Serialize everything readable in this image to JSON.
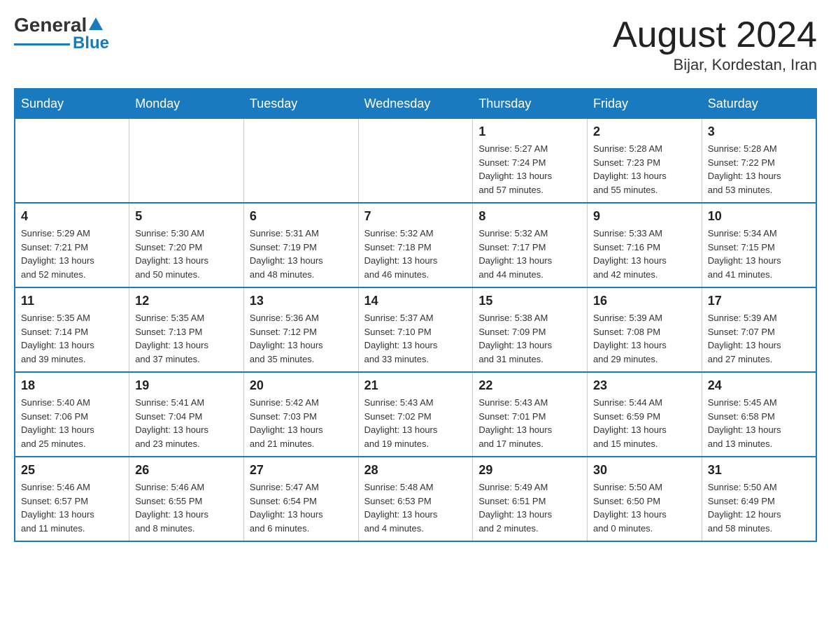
{
  "header": {
    "logo_general": "General",
    "logo_blue": "Blue",
    "month_title": "August 2024",
    "location": "Bijar, Kordestan, Iran"
  },
  "days_of_week": [
    "Sunday",
    "Monday",
    "Tuesday",
    "Wednesday",
    "Thursday",
    "Friday",
    "Saturday"
  ],
  "weeks": [
    [
      {
        "day": "",
        "info": ""
      },
      {
        "day": "",
        "info": ""
      },
      {
        "day": "",
        "info": ""
      },
      {
        "day": "",
        "info": ""
      },
      {
        "day": "1",
        "info": "Sunrise: 5:27 AM\nSunset: 7:24 PM\nDaylight: 13 hours\nand 57 minutes."
      },
      {
        "day": "2",
        "info": "Sunrise: 5:28 AM\nSunset: 7:23 PM\nDaylight: 13 hours\nand 55 minutes."
      },
      {
        "day": "3",
        "info": "Sunrise: 5:28 AM\nSunset: 7:22 PM\nDaylight: 13 hours\nand 53 minutes."
      }
    ],
    [
      {
        "day": "4",
        "info": "Sunrise: 5:29 AM\nSunset: 7:21 PM\nDaylight: 13 hours\nand 52 minutes."
      },
      {
        "day": "5",
        "info": "Sunrise: 5:30 AM\nSunset: 7:20 PM\nDaylight: 13 hours\nand 50 minutes."
      },
      {
        "day": "6",
        "info": "Sunrise: 5:31 AM\nSunset: 7:19 PM\nDaylight: 13 hours\nand 48 minutes."
      },
      {
        "day": "7",
        "info": "Sunrise: 5:32 AM\nSunset: 7:18 PM\nDaylight: 13 hours\nand 46 minutes."
      },
      {
        "day": "8",
        "info": "Sunrise: 5:32 AM\nSunset: 7:17 PM\nDaylight: 13 hours\nand 44 minutes."
      },
      {
        "day": "9",
        "info": "Sunrise: 5:33 AM\nSunset: 7:16 PM\nDaylight: 13 hours\nand 42 minutes."
      },
      {
        "day": "10",
        "info": "Sunrise: 5:34 AM\nSunset: 7:15 PM\nDaylight: 13 hours\nand 41 minutes."
      }
    ],
    [
      {
        "day": "11",
        "info": "Sunrise: 5:35 AM\nSunset: 7:14 PM\nDaylight: 13 hours\nand 39 minutes."
      },
      {
        "day": "12",
        "info": "Sunrise: 5:35 AM\nSunset: 7:13 PM\nDaylight: 13 hours\nand 37 minutes."
      },
      {
        "day": "13",
        "info": "Sunrise: 5:36 AM\nSunset: 7:12 PM\nDaylight: 13 hours\nand 35 minutes."
      },
      {
        "day": "14",
        "info": "Sunrise: 5:37 AM\nSunset: 7:10 PM\nDaylight: 13 hours\nand 33 minutes."
      },
      {
        "day": "15",
        "info": "Sunrise: 5:38 AM\nSunset: 7:09 PM\nDaylight: 13 hours\nand 31 minutes."
      },
      {
        "day": "16",
        "info": "Sunrise: 5:39 AM\nSunset: 7:08 PM\nDaylight: 13 hours\nand 29 minutes."
      },
      {
        "day": "17",
        "info": "Sunrise: 5:39 AM\nSunset: 7:07 PM\nDaylight: 13 hours\nand 27 minutes."
      }
    ],
    [
      {
        "day": "18",
        "info": "Sunrise: 5:40 AM\nSunset: 7:06 PM\nDaylight: 13 hours\nand 25 minutes."
      },
      {
        "day": "19",
        "info": "Sunrise: 5:41 AM\nSunset: 7:04 PM\nDaylight: 13 hours\nand 23 minutes."
      },
      {
        "day": "20",
        "info": "Sunrise: 5:42 AM\nSunset: 7:03 PM\nDaylight: 13 hours\nand 21 minutes."
      },
      {
        "day": "21",
        "info": "Sunrise: 5:43 AM\nSunset: 7:02 PM\nDaylight: 13 hours\nand 19 minutes."
      },
      {
        "day": "22",
        "info": "Sunrise: 5:43 AM\nSunset: 7:01 PM\nDaylight: 13 hours\nand 17 minutes."
      },
      {
        "day": "23",
        "info": "Sunrise: 5:44 AM\nSunset: 6:59 PM\nDaylight: 13 hours\nand 15 minutes."
      },
      {
        "day": "24",
        "info": "Sunrise: 5:45 AM\nSunset: 6:58 PM\nDaylight: 13 hours\nand 13 minutes."
      }
    ],
    [
      {
        "day": "25",
        "info": "Sunrise: 5:46 AM\nSunset: 6:57 PM\nDaylight: 13 hours\nand 11 minutes."
      },
      {
        "day": "26",
        "info": "Sunrise: 5:46 AM\nSunset: 6:55 PM\nDaylight: 13 hours\nand 8 minutes."
      },
      {
        "day": "27",
        "info": "Sunrise: 5:47 AM\nSunset: 6:54 PM\nDaylight: 13 hours\nand 6 minutes."
      },
      {
        "day": "28",
        "info": "Sunrise: 5:48 AM\nSunset: 6:53 PM\nDaylight: 13 hours\nand 4 minutes."
      },
      {
        "day": "29",
        "info": "Sunrise: 5:49 AM\nSunset: 6:51 PM\nDaylight: 13 hours\nand 2 minutes."
      },
      {
        "day": "30",
        "info": "Sunrise: 5:50 AM\nSunset: 6:50 PM\nDaylight: 13 hours\nand 0 minutes."
      },
      {
        "day": "31",
        "info": "Sunrise: 5:50 AM\nSunset: 6:49 PM\nDaylight: 12 hours\nand 58 minutes."
      }
    ]
  ]
}
